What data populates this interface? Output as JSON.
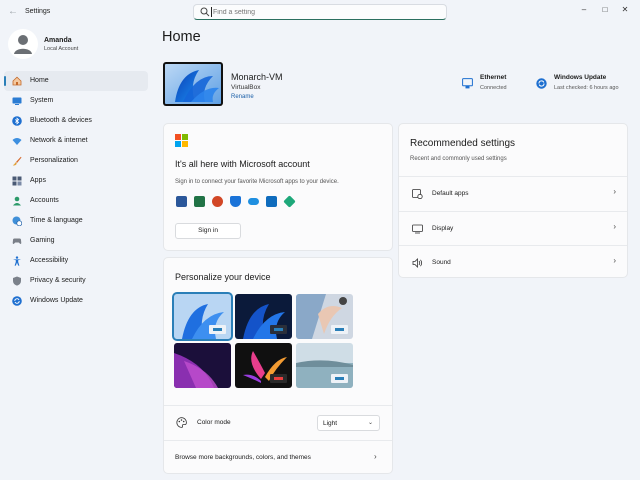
{
  "window": {
    "title": "Settings",
    "back_icon": "back-arrow-icon",
    "controls": [
      "minimize-icon",
      "maximize-icon",
      "close-icon"
    ]
  },
  "search": {
    "placeholder": "Find a setting",
    "value": ""
  },
  "profile": {
    "name": "Amanda",
    "account": "Local Account"
  },
  "sidebar": {
    "items": [
      {
        "label": "Home",
        "icon": "home-icon",
        "active": true
      },
      {
        "label": "System",
        "icon": "system-icon"
      },
      {
        "label": "Bluetooth & devices",
        "icon": "bluetooth-icon"
      },
      {
        "label": "Network & internet",
        "icon": "network-icon"
      },
      {
        "label": "Personalization",
        "icon": "brush-icon"
      },
      {
        "label": "Apps",
        "icon": "apps-icon"
      },
      {
        "label": "Accounts",
        "icon": "accounts-icon"
      },
      {
        "label": "Time & language",
        "icon": "globe-clock-icon"
      },
      {
        "label": "Gaming",
        "icon": "gamepad-icon"
      },
      {
        "label": "Accessibility",
        "icon": "accessibility-icon"
      },
      {
        "label": "Privacy & security",
        "icon": "shield-icon"
      },
      {
        "label": "Windows Update",
        "icon": "update-icon"
      }
    ]
  },
  "main": {
    "title": "Home",
    "device": {
      "name": "Monarch-VM",
      "model": "VirtualBox",
      "rename_label": "Rename"
    },
    "status": {
      "ethernet": {
        "title": "Ethernet",
        "sub": "Connected"
      },
      "update": {
        "title": "Windows Update",
        "sub": "Last checked: 6 hours ago"
      }
    },
    "ms_account": {
      "title": "It's all here with Microsoft account",
      "text": "Sign in to connect your favorite Microsoft apps to your device.",
      "apps": [
        "word-icon",
        "excel-icon",
        "powerpoint-icon",
        "defender-icon",
        "onedrive-icon",
        "outlook-icon",
        "family-icon"
      ],
      "signin_label": "Sign in"
    },
    "personalize": {
      "title": "Personalize your device",
      "themes": [
        "windows-light",
        "windows-dark",
        "glow",
        "sunrise",
        "flow",
        "captured-motion"
      ],
      "selected_theme": "windows-light",
      "color_mode_label": "Color mode",
      "color_mode_value": "Light",
      "browse_label": "Browse more backgrounds, colors, and themes"
    },
    "recommended": {
      "title": "Recommended settings",
      "subtitle": "Recent and commonly used settings",
      "items": [
        {
          "label": "Default apps",
          "icon": "default-apps-icon"
        },
        {
          "label": "Display",
          "icon": "display-icon"
        },
        {
          "label": "Sound",
          "icon": "sound-icon"
        }
      ]
    }
  },
  "colors": {
    "accent": "#2a7fb8",
    "background": "#f1f4f9",
    "card": "#fbfbfc"
  }
}
